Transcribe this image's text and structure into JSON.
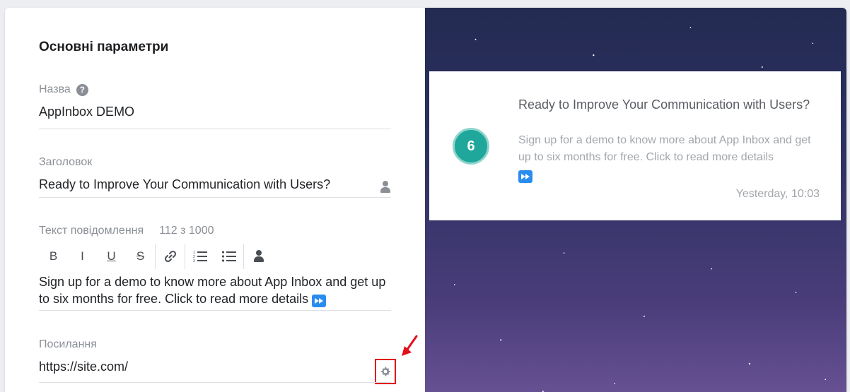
{
  "section": {
    "title": "Основні параметри"
  },
  "fields": {
    "name": {
      "label": "Назва",
      "value": "AppInbox DEMO"
    },
    "header": {
      "label": "Заголовок",
      "value": "Ready to Improve Your Communication with Users?"
    },
    "message": {
      "label": "Текст повідомлення",
      "counter": "112 з 1000",
      "value": "Sign up for a demo to know more about App Inbox and get up to six months for free. Click to read more details"
    },
    "link": {
      "label": "Посилання",
      "value": "https://site.com/"
    }
  },
  "toolbar": {
    "bold": "B",
    "italic": "I",
    "underline": "U",
    "strike": "S"
  },
  "preview": {
    "avatar_number": "6",
    "title": "Ready to Improve Your Communication with Users?",
    "body": "Sign up for a demo to know more about App Inbox and get up to six months for free. Click to read more details",
    "time": "Yesterday, 10:03"
  },
  "colors": {
    "accent_blue": "#2a8cef",
    "avatar_teal": "#1fa79b",
    "highlight_red": "#e3101b"
  },
  "icons": [
    "help-icon",
    "person-icon",
    "link-icon",
    "numbered-list-icon",
    "bulleted-list-icon",
    "fast-forward-icon",
    "gear-icon",
    "red-arrow"
  ]
}
